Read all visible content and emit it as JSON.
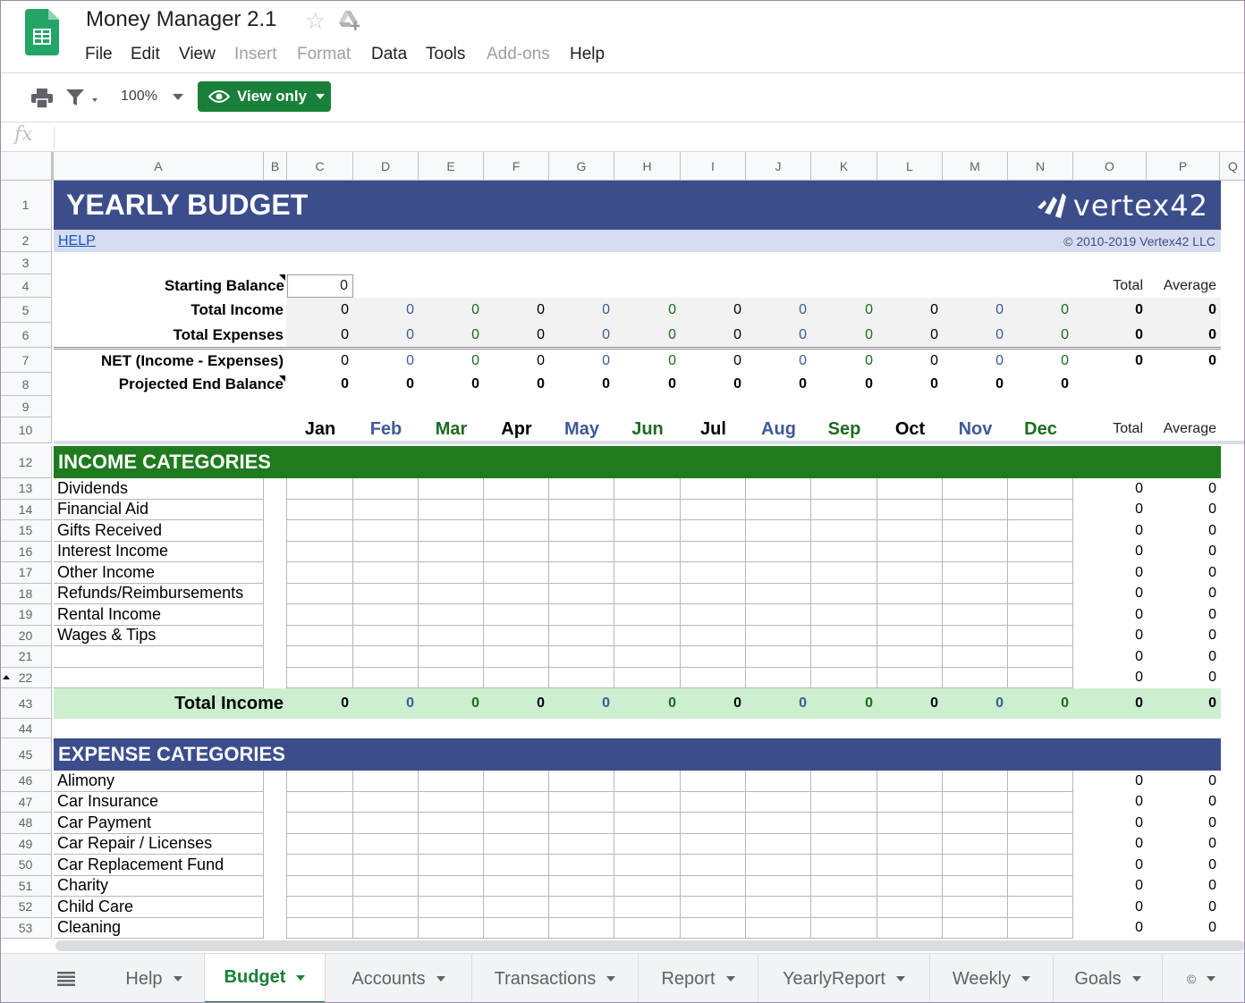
{
  "app": {
    "title": "Money Manager 2.1",
    "menu": [
      "File",
      "Edit",
      "View",
      "Insert",
      "Format",
      "Data",
      "Tools",
      "Add-ons",
      "Help"
    ],
    "menu_disabled": [
      false,
      false,
      false,
      true,
      true,
      false,
      false,
      true,
      false
    ]
  },
  "toolbar": {
    "zoom": "100%",
    "view_only": "View only",
    "fx": "fx"
  },
  "columns": [
    "A",
    "B",
    "C",
    "D",
    "E",
    "F",
    "G",
    "H",
    "I",
    "J",
    "K",
    "L",
    "M",
    "N",
    "O",
    "P",
    "Q"
  ],
  "sheet": {
    "title": "YEARLY BUDGET",
    "logo": "vertex42",
    "help_link": "HELP",
    "copyright": "© 2010-2019 Vertex42 LLC",
    "labels": {
      "starting_balance": "Starting Balance",
      "total_income": "Total Income",
      "total_expenses": "Total Expenses",
      "net": "NET (Income - Expenses)",
      "projected": "Projected End Balance",
      "total": "Total",
      "average": "Average"
    },
    "starting_balance_value": "0",
    "months": [
      "Jan",
      "Feb",
      "Mar",
      "Apr",
      "May",
      "Jun",
      "Jul",
      "Aug",
      "Sep",
      "Oct",
      "Nov",
      "Dec"
    ],
    "month_values": [
      "0",
      "0",
      "0",
      "0",
      "0",
      "0",
      "0",
      "0",
      "0",
      "0",
      "0",
      "0"
    ],
    "summary_total": "0",
    "summary_average": "0",
    "income_header": "INCOME CATEGORIES",
    "income_rows": [
      "Dividends",
      "Financial Aid",
      "Gifts Received",
      "Interest Income",
      "Other Income",
      "Refunds/Reimbursements",
      "Rental Income",
      "Wages & Tips",
      "",
      ""
    ],
    "income_total_label": "Total Income",
    "expense_header": "EXPENSE CATEGORIES",
    "expense_rows": [
      "Alimony",
      "Car Insurance",
      "Car Payment",
      "Car Repair / Licenses",
      "Car Replacement Fund",
      "Charity",
      "Child Care",
      "Cleaning"
    ],
    "row_total": "0",
    "row_average": "0"
  },
  "row_numbers": {
    "top": [
      "1",
      "2",
      "3",
      "4",
      "5",
      "6",
      "7",
      "8",
      "9",
      "10",
      "12"
    ],
    "income": [
      "13",
      "14",
      "15",
      "16",
      "17",
      "18",
      "19",
      "20",
      "21",
      "22"
    ],
    "total": "43",
    "gap": "44",
    "expense_header": "45",
    "expense": [
      "46",
      "47",
      "48",
      "49",
      "50",
      "51",
      "52",
      "53"
    ]
  },
  "tabs": [
    "Help",
    "Budget",
    "Accounts",
    "Transactions",
    "Report",
    "YearlyReport",
    "Weekly",
    "Goals",
    "©"
  ],
  "active_tab": "Budget",
  "colors": {
    "blue_header": "#3c4d8c",
    "green_header": "#1e7b1e",
    "income_total_bg": "#ccefd0",
    "accent": "#188038"
  }
}
